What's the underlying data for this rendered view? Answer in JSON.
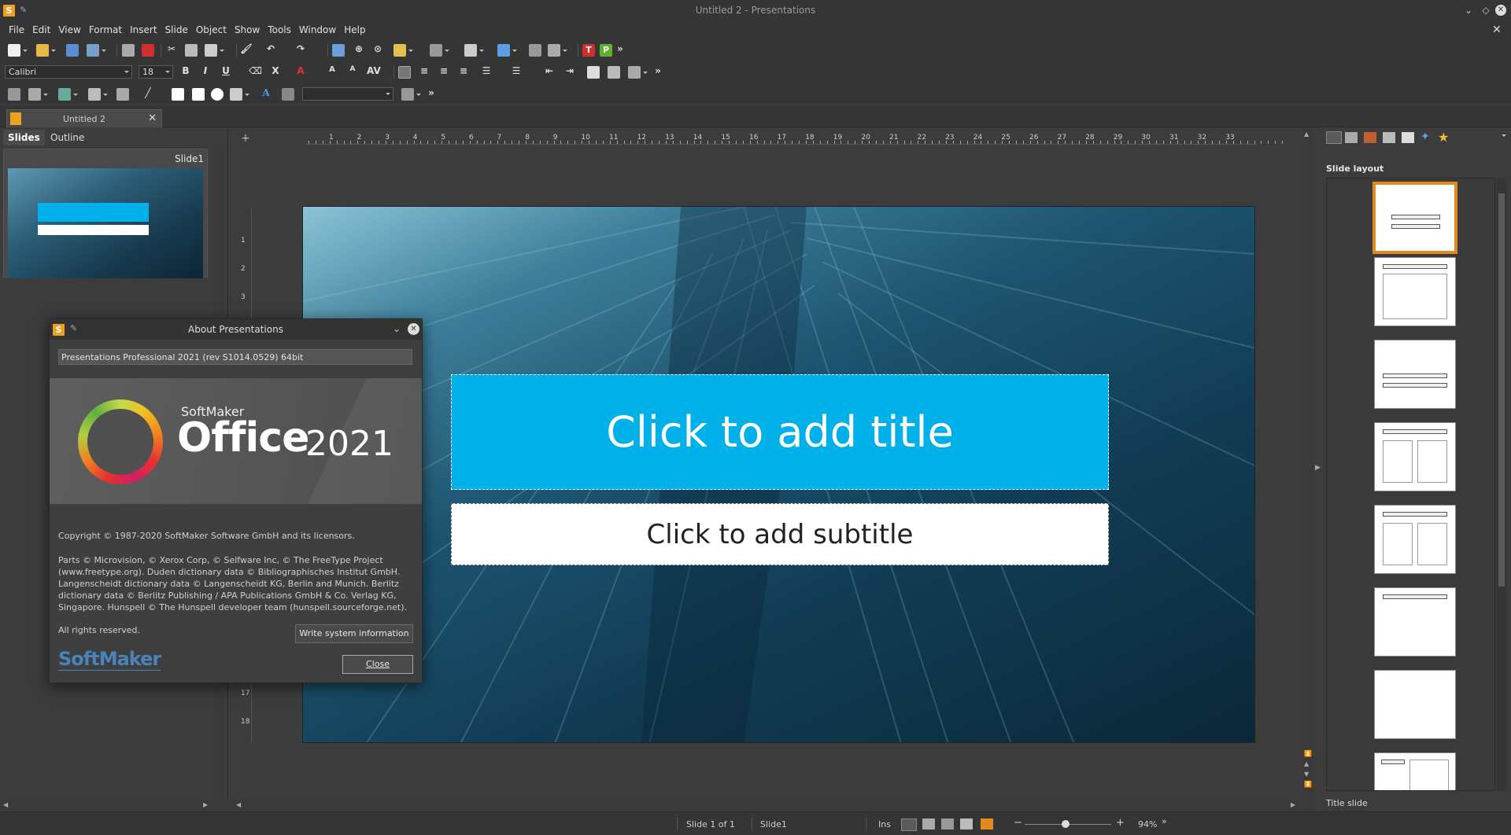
{
  "window": {
    "title": "Untitled 2 - Presentations",
    "app_icon": "S"
  },
  "menu": [
    "File",
    "Edit",
    "View",
    "Format",
    "Insert",
    "Slide",
    "Object",
    "Show",
    "Tools",
    "Window",
    "Help"
  ],
  "format_bar": {
    "font": "Calibri",
    "size": "18"
  },
  "doc_tab": {
    "label": "Untitled 2"
  },
  "left_pane": {
    "tabs": [
      "Slides",
      "Outline"
    ],
    "slide_label": "Slide1"
  },
  "ruler_numbers": [
    "1",
    "2",
    "3",
    "4",
    "5",
    "6",
    "7",
    "8",
    "9",
    "10",
    "11",
    "12",
    "13",
    "14",
    "15",
    "16",
    "17",
    "18",
    "19",
    "20",
    "21",
    "22",
    "23",
    "24",
    "25",
    "26",
    "27",
    "28",
    "29",
    "30",
    "31",
    "32",
    "33"
  ],
  "slide": {
    "title_placeholder": "Click to add title",
    "subtitle_placeholder": "Click to add subtitle"
  },
  "right_pane": {
    "section": "Slide layout",
    "footer": "Title slide"
  },
  "statusbar": {
    "slide_of": "Slide 1 of 1",
    "slide_name": "Slide1",
    "mode": "Ins",
    "zoom": "94%"
  },
  "dialog": {
    "title": "About Presentations",
    "version": "Presentations Professional 2021 (rev S1014.0529) 64bit",
    "brand_small": "SoftMaker",
    "brand_office": "Office",
    "brand_year": "2021",
    "copyright": "Copyright © 1987-2020 SoftMaker Software GmbH and its licensors.",
    "parts": "Parts © Microvision, © Xerox Corp, © Selfware Inc, © The FreeType Project (www.freetype.org). Duden dictionary data © Bibliographisches Institut GmbH. Langenscheidt dictionary data © Langenscheidt KG, Berlin and Munich. Berlitz dictionary data © Berlitz Publishing / APA Publications GmbH & Co. Verlag KG, Singapore. Hunspell © The Hunspell developer team (hunspell.sourceforge.net).",
    "rights": "All rights reserved.",
    "write_button": "Write system information",
    "close_button": "Close",
    "logo_text": "SoftMaker"
  },
  "colors": {
    "accent_title": "#00b0e8",
    "selection": "#e08a20"
  }
}
